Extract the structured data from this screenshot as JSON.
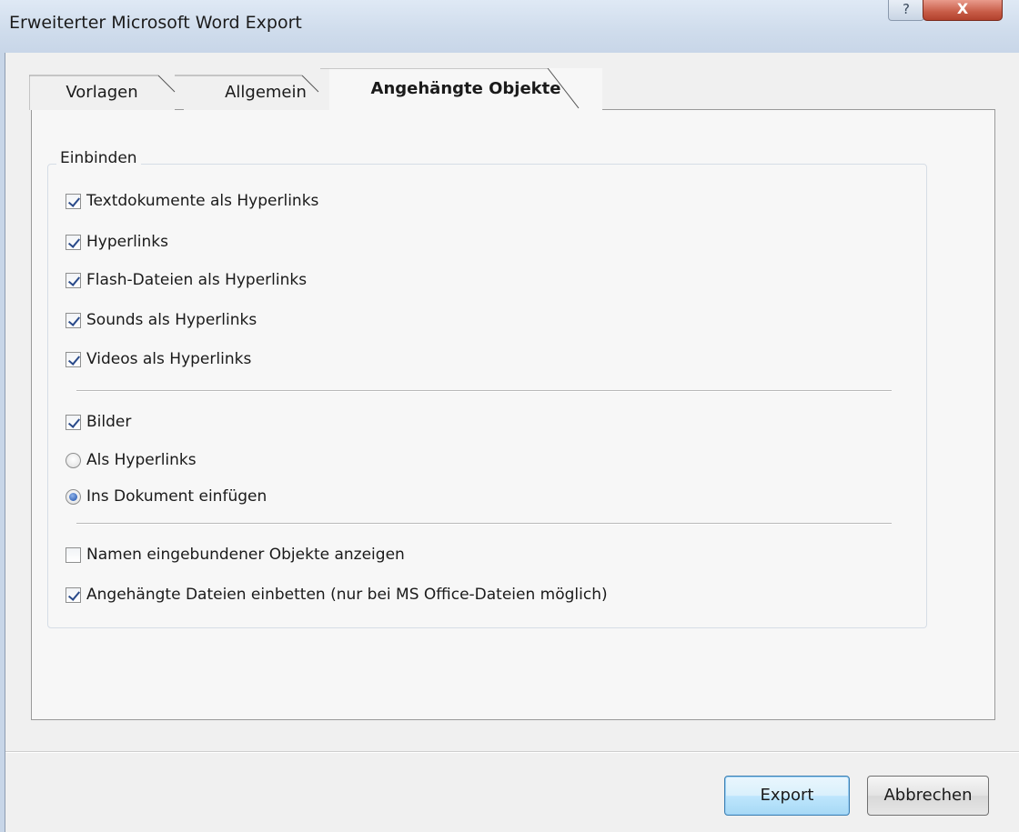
{
  "window": {
    "title": "Erweiterter Microsoft Word Export",
    "help_glyph": "?",
    "close_glyph": "X"
  },
  "tabs": [
    {
      "label": "Vorlagen",
      "active": false
    },
    {
      "label": "Allgemein",
      "active": false
    },
    {
      "label": "Angehängte Objekte",
      "active": true
    }
  ],
  "group": {
    "label": "Einbinden"
  },
  "options": {
    "textdokumente": {
      "label": "Textdokumente als Hyperlinks",
      "checked": true
    },
    "hyperlinks": {
      "label": "Hyperlinks",
      "checked": true
    },
    "flash": {
      "label": "Flash-Dateien als Hyperlinks",
      "checked": true
    },
    "sounds": {
      "label": "Sounds als Hyperlinks",
      "checked": true
    },
    "videos": {
      "label": "Videos als Hyperlinks",
      "checked": true
    },
    "bilder": {
      "label": "Bilder",
      "checked": true
    },
    "als_hyperlinks": {
      "label": "Als Hyperlinks",
      "selected": false
    },
    "ins_dokument": {
      "label": "Ins Dokument einfügen",
      "selected": true
    },
    "namen": {
      "label": "Namen eingebundener Objekte anzeigen",
      "checked": false
    },
    "einbetten": {
      "label": "Angehängte Dateien einbetten (nur bei MS Office-Dateien möglich)",
      "checked": true
    }
  },
  "buttons": {
    "export": "Export",
    "cancel": "Abbrechen"
  },
  "icons": {
    "help": "help-icon",
    "close": "close-icon"
  }
}
